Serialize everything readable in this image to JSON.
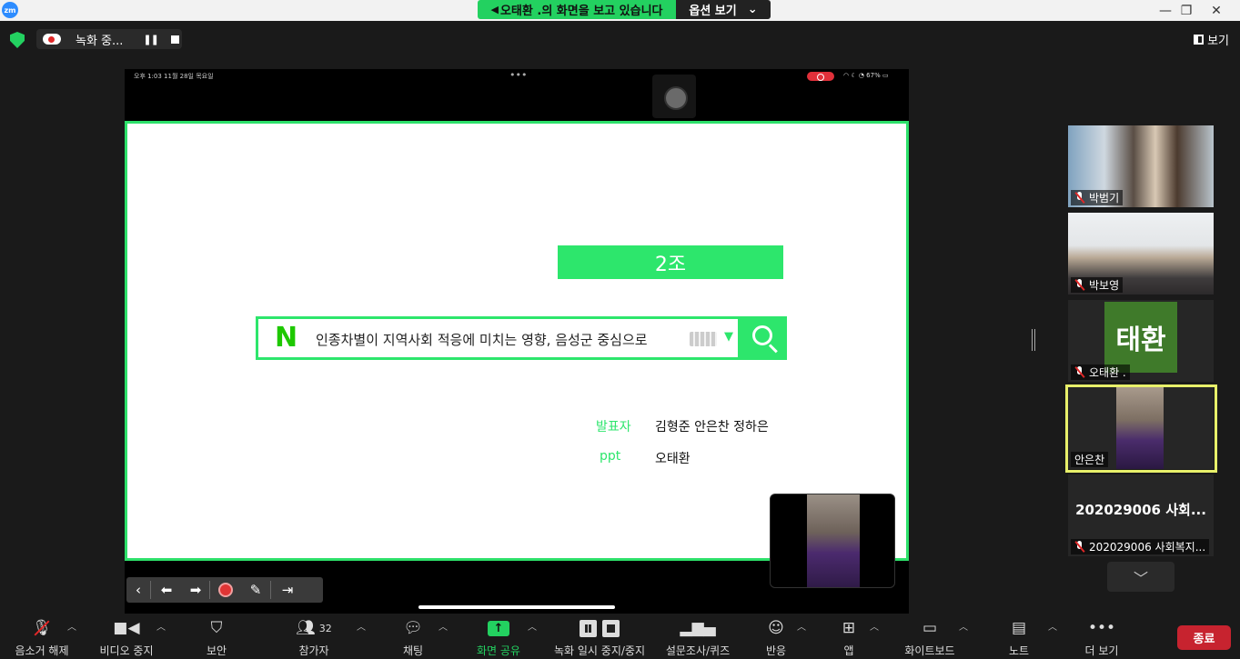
{
  "titlebar": {
    "logo_text": "zm",
    "viewing_banner": "오태환 .의 화면을 보고 있습니다",
    "view_options": "옵션 보기",
    "window_controls": [
      "—",
      "❐",
      "✕"
    ]
  },
  "toprow": {
    "recording_label": "녹화 중...",
    "view_button": "보기"
  },
  "ipad": {
    "status_time": "오후 1:03   11월 28일 목요일",
    "battery": "67%"
  },
  "slide": {
    "group": "2조",
    "search_text": "인종차별이 지역사회 적응에 미치는 영향, 음성군 중심으로",
    "presenter_label": "발표자",
    "presenters": "김형준  안은찬  정하은",
    "ppt_label": "ppt",
    "ppt_author": "오태환"
  },
  "participants": [
    {
      "name": "박범기",
      "muted": true
    },
    {
      "name": "박보영",
      "muted": true
    },
    {
      "name": "오태환 .",
      "muted": true,
      "avatar": "태환"
    },
    {
      "name": "안은찬",
      "muted": false,
      "active": true
    },
    {
      "name": "202029006 사회복지...",
      "muted": true,
      "title": "202029006 사회..."
    }
  ],
  "bottombar": {
    "unmute": "음소거 해제",
    "video": "비디오 중지",
    "security": "보안",
    "participants": "참가자",
    "participants_count": "32",
    "chat": "채팅",
    "share": "화면 공유",
    "recording": "녹화 일시 중지/중지",
    "polls": "설문조사/퀴즈",
    "reactions": "반응",
    "apps": "앱",
    "whiteboard": "화이트보드",
    "notes": "노트",
    "more": "더 보기",
    "end": "종료"
  },
  "colors": {
    "accent_green": "#23d160",
    "slide_green": "#2de66c",
    "end_red": "#c7232f",
    "active_speaker": "#e8f06a"
  }
}
